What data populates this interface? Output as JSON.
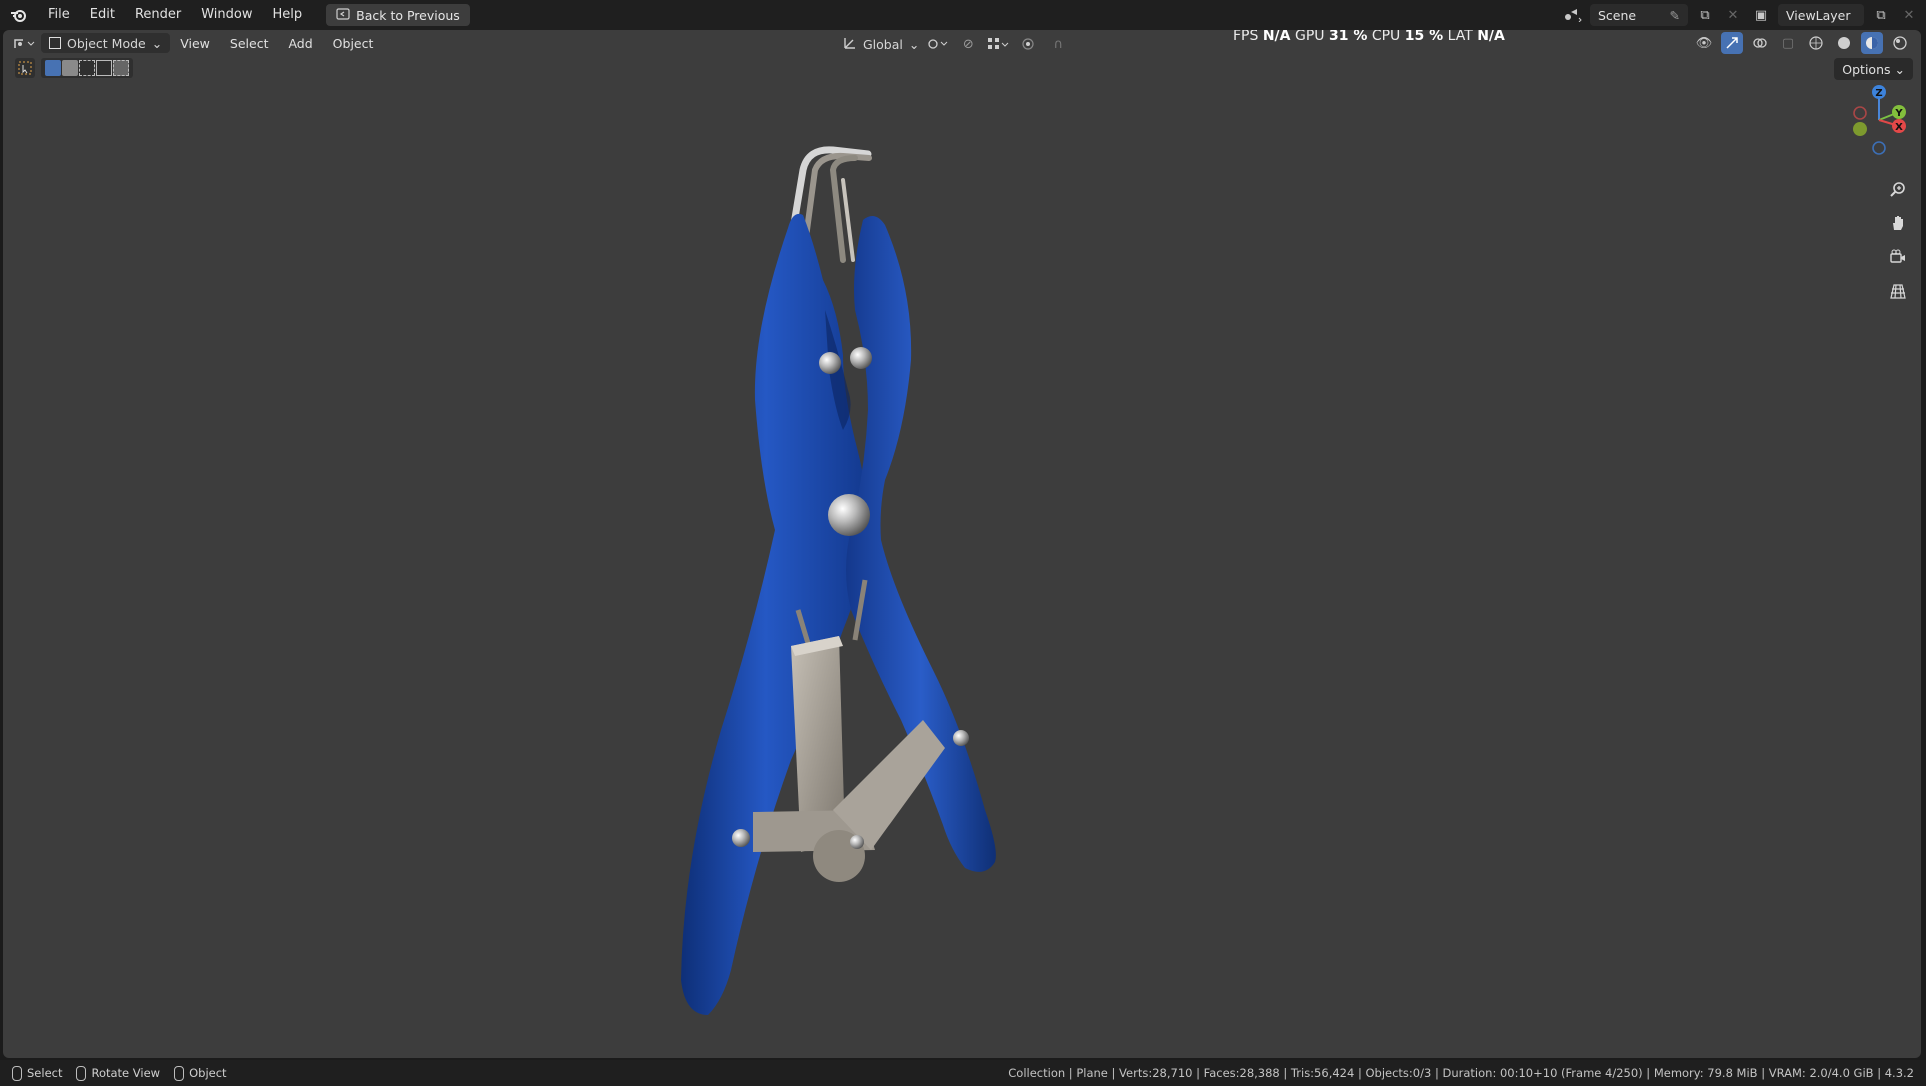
{
  "menu": {
    "items": [
      "File",
      "Edit",
      "Render",
      "Window",
      "Help"
    ],
    "back_button": "Back to Previous"
  },
  "topbar_right": {
    "scene": "Scene",
    "view_layer": "ViewLayer"
  },
  "viewport_header": {
    "mode": "Object Mode",
    "menus": [
      "View",
      "Select",
      "Add",
      "Object"
    ],
    "orientation": "Global",
    "options": "Options"
  },
  "stats": {
    "fps_label": "FPS",
    "fps_value": "N/A",
    "gpu_label": "GPU",
    "gpu_value": "31 %",
    "cpu_label": "CPU",
    "cpu_value": "15 %",
    "lat_label": "LAT",
    "lat_value": "N/A"
  },
  "gizmo": {
    "z": "Z",
    "y": "Y",
    "x": "X"
  },
  "statusbar": {
    "select": "Select",
    "rotate": "Rotate View",
    "object": "Object",
    "info": "Collection | Plane | Verts:28,710 | Faces:28,388 | Tris:56,424 | Objects:0/3 | Duration: 00:10+10 (Frame 4/250) | Memory: 79.8 MiB | VRAM: 2.0/4.0 GiB | 4.3.2"
  },
  "colors": {
    "viewport_bg": "#3d3d3d",
    "handle_blue": "#1f4fb0",
    "metal": "#a9a39a"
  }
}
